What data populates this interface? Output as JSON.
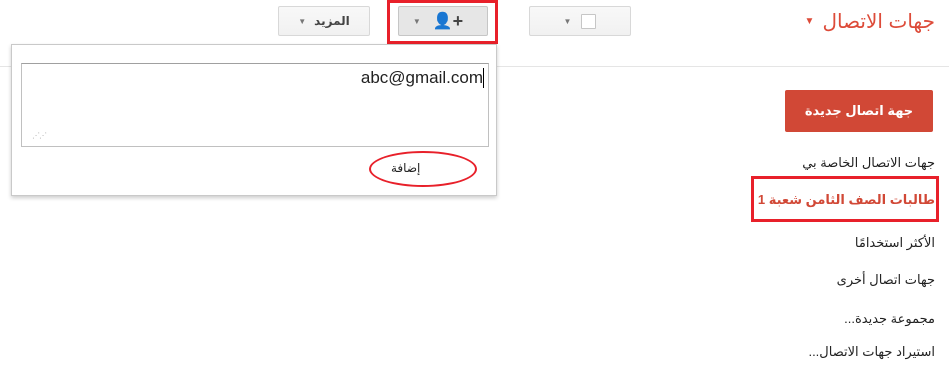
{
  "header": {
    "title": "جهات الاتصال",
    "more_label": "المزيد"
  },
  "add_panel": {
    "email_value": "abc@gmail.com",
    "add_label": "إضافة"
  },
  "sidebar": {
    "new_contact_label": "جهة اتصال جديدة",
    "my_contacts": "جهات الاتصال الخاصة بي",
    "group": "طالبات الصف الثامن شعبة 1",
    "most_used": "الأكثر استخدامًا",
    "other_contacts": "جهات اتصال أخرى",
    "new_group": "مجموعة جديدة...",
    "import": "استيراد جهات الاتصال..."
  },
  "colors": {
    "accent": "#dd4b39",
    "primary_button": "#d14836",
    "highlight": "#e8202a"
  }
}
